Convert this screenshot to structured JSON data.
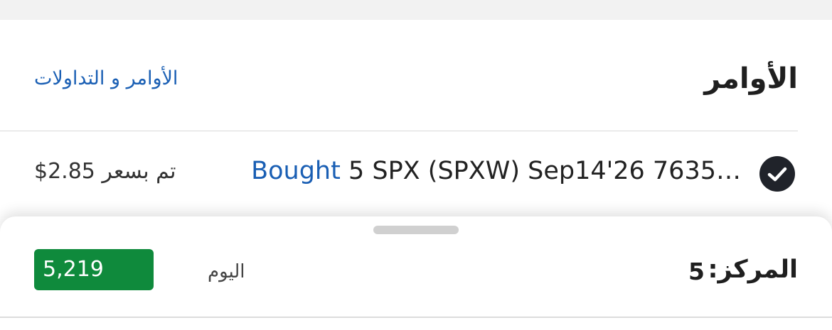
{
  "orders": {
    "title": "الأوامر",
    "link_label": "الأوامر و التداولات"
  },
  "order_row": {
    "status_icon": "check-circle-icon",
    "verb": "Bought",
    "description": " 5 SPX (SPXW) Sep14'26 7635…",
    "price_text": "تم بسعر 2.85$"
  },
  "position_sheet": {
    "label": "المركز:",
    "value": "5",
    "period_label": "اليوم",
    "day_value": "5,219"
  },
  "colors": {
    "link_blue": "#1a5fb4",
    "badge_green": "#0f8a3c",
    "icon_dark": "#20232a"
  }
}
